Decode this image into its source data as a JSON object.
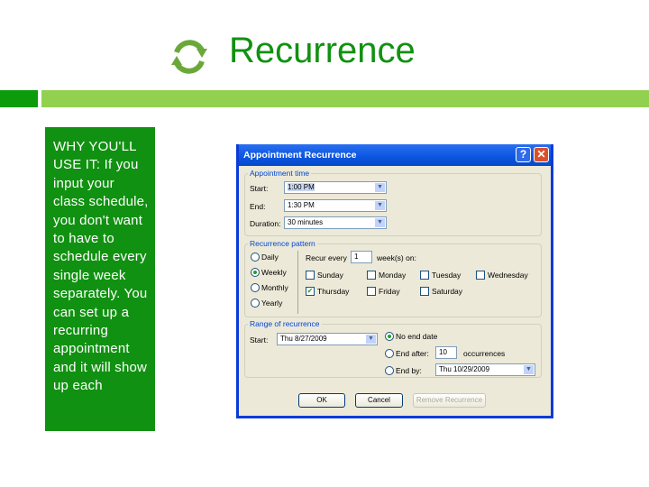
{
  "slide": {
    "title": "Recurrence",
    "side_text": "WHY YOU'LL USE IT: If you input your class schedule, you don't want to have to schedule every single week separately. You can set up a recurring appointment and it will show up each",
    "colors": {
      "title": "#119111",
      "accent_dark": "#0b9b0b",
      "accent_light": "#92d050"
    }
  },
  "dialog": {
    "title": "Appointment Recurrence",
    "help": "?",
    "close": "✕",
    "time": {
      "label": "Appointment time",
      "start_label": "Start:",
      "start": "1:00 PM",
      "end_label": "End:",
      "end": "1:30 PM",
      "duration_label": "Duration:",
      "duration": "30 minutes"
    },
    "pattern": {
      "label": "Recurrence pattern",
      "daily": "Daily",
      "weekly": "Weekly",
      "monthly": "Monthly",
      "yearly": "Yearly",
      "recur_every": "Recur every",
      "interval": "1",
      "weeks_on": "week(s) on:",
      "days": [
        {
          "label": "Sunday",
          "checked": false
        },
        {
          "label": "Monday",
          "checked": false
        },
        {
          "label": "Tuesday",
          "checked": false
        },
        {
          "label": "Wednesday",
          "checked": false
        },
        {
          "label": "Thursday",
          "checked": true
        },
        {
          "label": "Friday",
          "checked": false
        },
        {
          "label": "Saturday",
          "checked": false
        }
      ]
    },
    "range": {
      "label": "Range of recurrence",
      "start_label": "Start:",
      "start": "Thu 8/27/2009",
      "no_end": "No end date",
      "end_after": "End after:",
      "occurrences_value": "10",
      "occurrences": "occurrences",
      "end_by": "End by:",
      "end_by_value": "Thu 10/29/2009"
    },
    "buttons": {
      "ok": "OK",
      "cancel": "Cancel",
      "remove": "Remove Recurrence"
    }
  }
}
